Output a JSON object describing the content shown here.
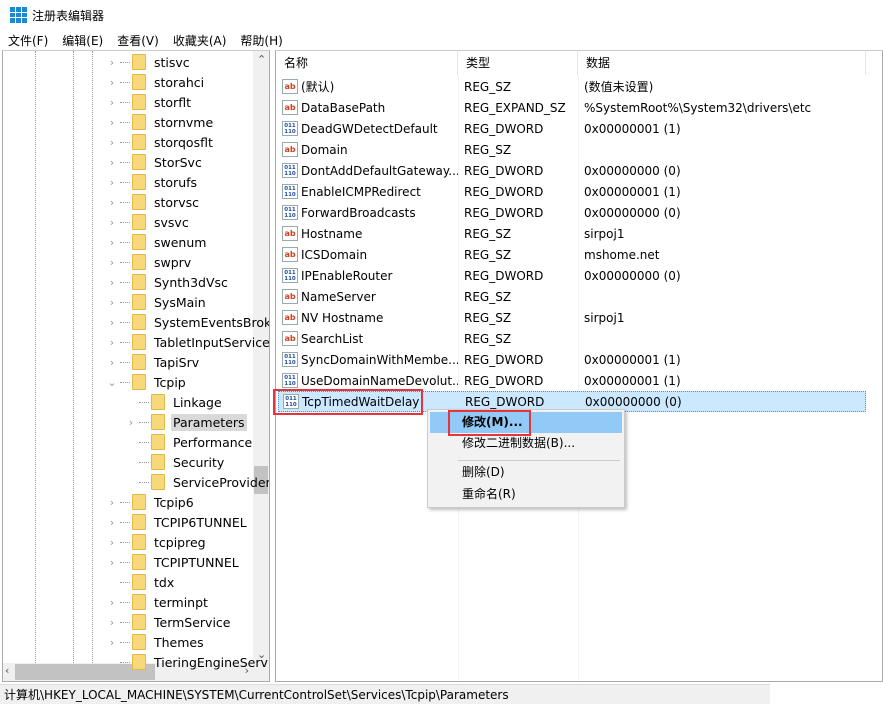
{
  "window": {
    "title": "注册表编辑器",
    "accent": "#1a8ad4"
  },
  "menu": [
    "文件(F)",
    "编辑(E)",
    "查看(V)",
    "收藏夹(A)",
    "帮助(H)"
  ],
  "tree": {
    "items": [
      {
        "label": "stisvc",
        "depth": 0,
        "expandable": true
      },
      {
        "label": "storahci",
        "depth": 0,
        "expandable": true
      },
      {
        "label": "storflt",
        "depth": 0,
        "expandable": true
      },
      {
        "label": "stornvme",
        "depth": 0,
        "expandable": true
      },
      {
        "label": "storqosflt",
        "depth": 0,
        "expandable": true
      },
      {
        "label": "StorSvc",
        "depth": 0,
        "expandable": true
      },
      {
        "label": "storufs",
        "depth": 0,
        "expandable": true
      },
      {
        "label": "storvsc",
        "depth": 0,
        "expandable": true
      },
      {
        "label": "svsvc",
        "depth": 0,
        "expandable": true
      },
      {
        "label": "swenum",
        "depth": 0,
        "expandable": true
      },
      {
        "label": "swprv",
        "depth": 0,
        "expandable": true
      },
      {
        "label": "Synth3dVsc",
        "depth": 0,
        "expandable": true
      },
      {
        "label": "SysMain",
        "depth": 0,
        "expandable": true
      },
      {
        "label": "SystemEventsBroker",
        "depth": 0,
        "expandable": true
      },
      {
        "label": "TabletInputService",
        "depth": 0,
        "expandable": true
      },
      {
        "label": "TapiSrv",
        "depth": 0,
        "expandable": true
      },
      {
        "label": "Tcpip",
        "depth": 0,
        "expanded": true
      },
      {
        "label": "Linkage",
        "depth": 1,
        "expandable": false
      },
      {
        "label": "Parameters",
        "depth": 1,
        "expandable": true,
        "selected": true
      },
      {
        "label": "Performance",
        "depth": 1,
        "expandable": false
      },
      {
        "label": "Security",
        "depth": 1,
        "expandable": false
      },
      {
        "label": "ServiceProvider",
        "depth": 1,
        "expandable": false
      },
      {
        "label": "Tcpip6",
        "depth": 0,
        "expandable": true
      },
      {
        "label": "TCPIP6TUNNEL",
        "depth": 0,
        "expandable": true
      },
      {
        "label": "tcpipreg",
        "depth": 0,
        "expandable": true
      },
      {
        "label": "TCPIPTUNNEL",
        "depth": 0,
        "expandable": true
      },
      {
        "label": "tdx",
        "depth": 0,
        "expandable": false
      },
      {
        "label": "terminpt",
        "depth": 0,
        "expandable": true
      },
      {
        "label": "TermService",
        "depth": 0,
        "expandable": true
      },
      {
        "label": "Themes",
        "depth": 0,
        "expandable": true
      },
      {
        "label": "TieringEngineService",
        "depth": 0,
        "expandable": false
      }
    ]
  },
  "list": {
    "headers": [
      "名称",
      "类型",
      "数据"
    ],
    "rows": [
      {
        "icon": "sz",
        "name": "(默认)",
        "type": "REG_SZ",
        "data": "(数值未设置)"
      },
      {
        "icon": "sz",
        "name": "DataBasePath",
        "type": "REG_EXPAND_SZ",
        "data": "%SystemRoot%\\System32\\drivers\\etc"
      },
      {
        "icon": "dw",
        "name": "DeadGWDetectDefault",
        "type": "REG_DWORD",
        "data": "0x00000001 (1)"
      },
      {
        "icon": "sz",
        "name": "Domain",
        "type": "REG_SZ",
        "data": ""
      },
      {
        "icon": "dw",
        "name": "DontAddDefaultGateway...",
        "type": "REG_DWORD",
        "data": "0x00000000 (0)"
      },
      {
        "icon": "dw",
        "name": "EnableICMPRedirect",
        "type": "REG_DWORD",
        "data": "0x00000001 (1)"
      },
      {
        "icon": "dw",
        "name": "ForwardBroadcasts",
        "type": "REG_DWORD",
        "data": "0x00000000 (0)"
      },
      {
        "icon": "sz",
        "name": "Hostname",
        "type": "REG_SZ",
        "data": "sirpoj1"
      },
      {
        "icon": "sz",
        "name": "ICSDomain",
        "type": "REG_SZ",
        "data": "mshome.net"
      },
      {
        "icon": "dw",
        "name": "IPEnableRouter",
        "type": "REG_DWORD",
        "data": "0x00000000 (0)"
      },
      {
        "icon": "sz",
        "name": "NameServer",
        "type": "REG_SZ",
        "data": ""
      },
      {
        "icon": "sz",
        "name": "NV Hostname",
        "type": "REG_SZ",
        "data": "sirpoj1"
      },
      {
        "icon": "sz",
        "name": "SearchList",
        "type": "REG_SZ",
        "data": ""
      },
      {
        "icon": "dw",
        "name": "SyncDomainWithMembe...",
        "type": "REG_DWORD",
        "data": "0x00000001 (1)"
      },
      {
        "icon": "dw",
        "name": "UseDomainNameDevolut...",
        "type": "REG_DWORD",
        "data": "0x00000001 (1)"
      },
      {
        "icon": "dw",
        "name": "TcpTimedWaitDelay",
        "type": "REG_DWORD",
        "data": "0x00000000 (0)",
        "selected": true
      }
    ]
  },
  "context_menu": {
    "items": [
      "修改(M)...",
      "修改二进制数据(B)...",
      "删除(D)",
      "重命名(R)"
    ],
    "highlighted": 0
  },
  "status": "计算机\\HKEY_LOCAL_MACHINE\\SYSTEM\\CurrentControlSet\\Services\\Tcpip\\Parameters",
  "icons": {
    "sz": "ab",
    "dw": "011\n110"
  }
}
